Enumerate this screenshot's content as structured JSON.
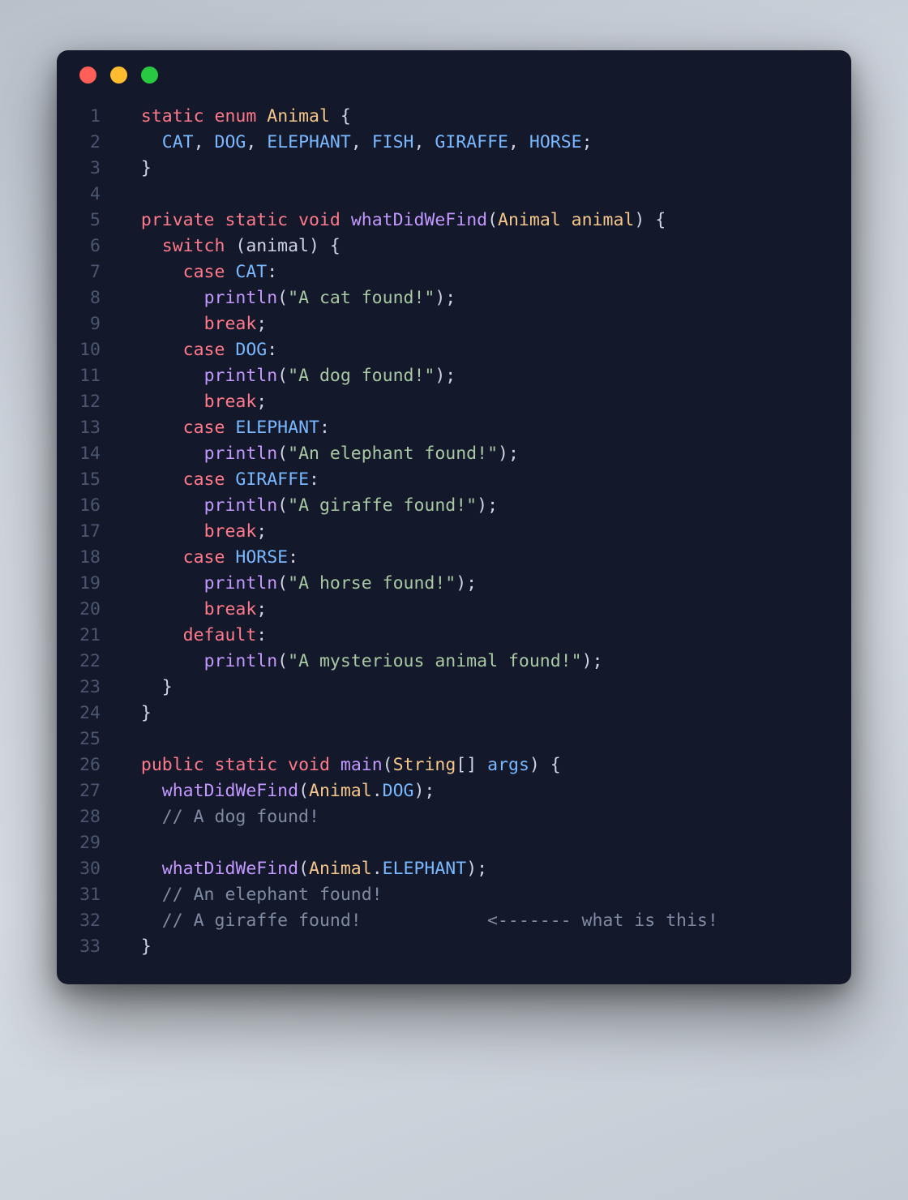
{
  "window_controls": {
    "close": "close",
    "minimize": "minimize",
    "zoom": "zoom"
  },
  "colors": {
    "background": "#13182a",
    "keyword": "#ff7a8b",
    "type": "#f6c78a",
    "function": "#c399ff",
    "identifier": "#7ab8ff",
    "string": "#a9c9a4",
    "comment": "#7f8aa3",
    "gutter": "#4b5670"
  },
  "code": {
    "lines": [
      {
        "n": "1",
        "tokens": [
          [
            "pun",
            "  "
          ],
          [
            "kw",
            "static"
          ],
          [
            "pun",
            " "
          ],
          [
            "kw",
            "enum"
          ],
          [
            "pun",
            " "
          ],
          [
            "type",
            "Animal"
          ],
          [
            "pun",
            " {"
          ]
        ]
      },
      {
        "n": "2",
        "tokens": [
          [
            "pun",
            "    "
          ],
          [
            "id",
            "CAT"
          ],
          [
            "pun",
            ", "
          ],
          [
            "id",
            "DOG"
          ],
          [
            "pun",
            ", "
          ],
          [
            "id",
            "ELEPHANT"
          ],
          [
            "pun",
            ", "
          ],
          [
            "id",
            "FISH"
          ],
          [
            "pun",
            ", "
          ],
          [
            "id",
            "GIRAFFE"
          ],
          [
            "pun",
            ", "
          ],
          [
            "id",
            "HORSE"
          ],
          [
            "pun",
            ";"
          ]
        ]
      },
      {
        "n": "3",
        "tokens": [
          [
            "pun",
            "  }"
          ]
        ]
      },
      {
        "n": "4",
        "tokens": [
          [
            "pun",
            ""
          ]
        ]
      },
      {
        "n": "5",
        "tokens": [
          [
            "pun",
            "  "
          ],
          [
            "kw",
            "private"
          ],
          [
            "pun",
            " "
          ],
          [
            "kw",
            "static"
          ],
          [
            "pun",
            " "
          ],
          [
            "kw",
            "void"
          ],
          [
            "pun",
            " "
          ],
          [
            "fn",
            "whatDidWeFind"
          ],
          [
            "pun",
            "("
          ],
          [
            "type",
            "Animal"
          ],
          [
            "pun",
            " "
          ],
          [
            "param",
            "animal"
          ],
          [
            "pun",
            ") {"
          ]
        ]
      },
      {
        "n": "6",
        "tokens": [
          [
            "pun",
            "    "
          ],
          [
            "kw",
            "switch"
          ],
          [
            "pun",
            " (animal) {"
          ]
        ]
      },
      {
        "n": "7",
        "tokens": [
          [
            "pun",
            "      "
          ],
          [
            "kw",
            "case"
          ],
          [
            "pun",
            " "
          ],
          [
            "id",
            "CAT"
          ],
          [
            "pun",
            ":"
          ]
        ]
      },
      {
        "n": "8",
        "tokens": [
          [
            "pun",
            "        "
          ],
          [
            "fn",
            "println"
          ],
          [
            "pun",
            "("
          ],
          [
            "str",
            "\"A cat found!\""
          ],
          [
            "pun",
            ");"
          ]
        ]
      },
      {
        "n": "9",
        "tokens": [
          [
            "pun",
            "        "
          ],
          [
            "kw",
            "break"
          ],
          [
            "pun",
            ";"
          ]
        ]
      },
      {
        "n": "10",
        "tokens": [
          [
            "pun",
            "      "
          ],
          [
            "kw",
            "case"
          ],
          [
            "pun",
            " "
          ],
          [
            "id",
            "DOG"
          ],
          [
            "pun",
            ":"
          ]
        ]
      },
      {
        "n": "11",
        "tokens": [
          [
            "pun",
            "        "
          ],
          [
            "fn",
            "println"
          ],
          [
            "pun",
            "("
          ],
          [
            "str",
            "\"A dog found!\""
          ],
          [
            "pun",
            ");"
          ]
        ]
      },
      {
        "n": "12",
        "tokens": [
          [
            "pun",
            "        "
          ],
          [
            "kw",
            "break"
          ],
          [
            "pun",
            ";"
          ]
        ]
      },
      {
        "n": "13",
        "tokens": [
          [
            "pun",
            "      "
          ],
          [
            "kw",
            "case"
          ],
          [
            "pun",
            " "
          ],
          [
            "id",
            "ELEPHANT"
          ],
          [
            "pun",
            ":"
          ]
        ]
      },
      {
        "n": "14",
        "tokens": [
          [
            "pun",
            "        "
          ],
          [
            "fn",
            "println"
          ],
          [
            "pun",
            "("
          ],
          [
            "str",
            "\"An elephant found!\""
          ],
          [
            "pun",
            ");"
          ]
        ]
      },
      {
        "n": "15",
        "tokens": [
          [
            "pun",
            "      "
          ],
          [
            "kw",
            "case"
          ],
          [
            "pun",
            " "
          ],
          [
            "id",
            "GIRAFFE"
          ],
          [
            "pun",
            ":"
          ]
        ]
      },
      {
        "n": "16",
        "tokens": [
          [
            "pun",
            "        "
          ],
          [
            "fn",
            "println"
          ],
          [
            "pun",
            "("
          ],
          [
            "str",
            "\"A giraffe found!\""
          ],
          [
            "pun",
            ");"
          ]
        ]
      },
      {
        "n": "17",
        "tokens": [
          [
            "pun",
            "        "
          ],
          [
            "kw",
            "break"
          ],
          [
            "pun",
            ";"
          ]
        ]
      },
      {
        "n": "18",
        "tokens": [
          [
            "pun",
            "      "
          ],
          [
            "kw",
            "case"
          ],
          [
            "pun",
            " "
          ],
          [
            "id",
            "HORSE"
          ],
          [
            "pun",
            ":"
          ]
        ]
      },
      {
        "n": "19",
        "tokens": [
          [
            "pun",
            "        "
          ],
          [
            "fn",
            "println"
          ],
          [
            "pun",
            "("
          ],
          [
            "str",
            "\"A horse found!\""
          ],
          [
            "pun",
            ");"
          ]
        ]
      },
      {
        "n": "20",
        "tokens": [
          [
            "pun",
            "        "
          ],
          [
            "kw",
            "break"
          ],
          [
            "pun",
            ";"
          ]
        ]
      },
      {
        "n": "21",
        "tokens": [
          [
            "pun",
            "      "
          ],
          [
            "kw",
            "default"
          ],
          [
            "pun",
            ":"
          ]
        ]
      },
      {
        "n": "22",
        "tokens": [
          [
            "pun",
            "        "
          ],
          [
            "fn",
            "println"
          ],
          [
            "pun",
            "("
          ],
          [
            "str",
            "\"A mysterious animal found!\""
          ],
          [
            "pun",
            ");"
          ]
        ]
      },
      {
        "n": "23",
        "tokens": [
          [
            "pun",
            "    }"
          ]
        ]
      },
      {
        "n": "24",
        "tokens": [
          [
            "pun",
            "  }"
          ]
        ]
      },
      {
        "n": "25",
        "tokens": [
          [
            "pun",
            ""
          ]
        ]
      },
      {
        "n": "26",
        "tokens": [
          [
            "pun",
            "  "
          ],
          [
            "kw",
            "public"
          ],
          [
            "pun",
            " "
          ],
          [
            "kw",
            "static"
          ],
          [
            "pun",
            " "
          ],
          [
            "kw",
            "void"
          ],
          [
            "pun",
            " "
          ],
          [
            "fn",
            "main"
          ],
          [
            "pun",
            "("
          ],
          [
            "type",
            "String"
          ],
          [
            "pun",
            "[] "
          ],
          [
            "id",
            "args"
          ],
          [
            "pun",
            ") {"
          ]
        ]
      },
      {
        "n": "27",
        "tokens": [
          [
            "pun",
            "    "
          ],
          [
            "fn",
            "whatDidWeFind"
          ],
          [
            "pun",
            "("
          ],
          [
            "type",
            "Animal"
          ],
          [
            "pun",
            "."
          ],
          [
            "id",
            "DOG"
          ],
          [
            "pun",
            ");"
          ]
        ]
      },
      {
        "n": "28",
        "tokens": [
          [
            "pun",
            "    "
          ],
          [
            "cmt",
            "// A dog found!"
          ]
        ]
      },
      {
        "n": "29",
        "tokens": [
          [
            "pun",
            ""
          ]
        ]
      },
      {
        "n": "30",
        "tokens": [
          [
            "pun",
            "    "
          ],
          [
            "fn",
            "whatDidWeFind"
          ],
          [
            "pun",
            "("
          ],
          [
            "type",
            "Animal"
          ],
          [
            "pun",
            "."
          ],
          [
            "id",
            "ELEPHANT"
          ],
          [
            "pun",
            ");"
          ]
        ]
      },
      {
        "n": "31",
        "tokens": [
          [
            "pun",
            "    "
          ],
          [
            "cmt",
            "// An elephant found!"
          ]
        ]
      },
      {
        "n": "32",
        "tokens": [
          [
            "pun",
            "    "
          ],
          [
            "cmt",
            "// A giraffe found!            <------- what is this!"
          ]
        ]
      },
      {
        "n": "33",
        "tokens": [
          [
            "pun",
            "  }"
          ]
        ]
      }
    ]
  }
}
